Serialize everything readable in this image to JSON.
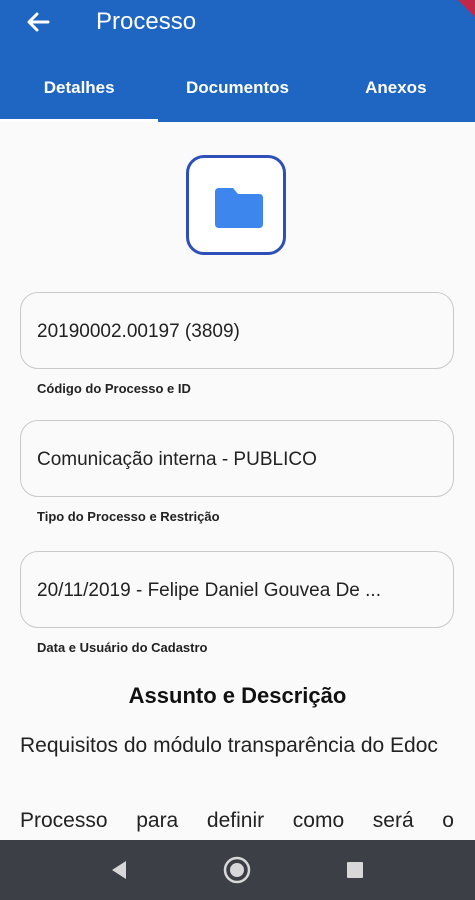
{
  "header": {
    "title": "Processo"
  },
  "tabs": [
    {
      "label": "Detalhes"
    },
    {
      "label": "Documentos"
    },
    {
      "label": "Anexos"
    }
  ],
  "fields": [
    {
      "value": "20190002.00197 (3809)",
      "label": "Código do Processo e ID"
    },
    {
      "value": "Comunicação interna - PUBLICO",
      "label": "Tipo do Processo e Restrição"
    },
    {
      "value": "20/11/2019 - Felipe Daniel Gouvea De ...",
      "label": "Data e Usuário do Cadastro"
    }
  ],
  "section": {
    "title": "Assunto e Descrição",
    "subject": "Requisitos do módulo transparência do Edoc",
    "description": "Processo para definir como será o"
  },
  "colors": {
    "appbar": "#1f65c2",
    "folder": "#3d86ee",
    "accent_border": "#2f4fb8"
  },
  "icons": {
    "back": "arrow-left-icon",
    "folder": "folder-icon",
    "nav_back": "triangle-back-icon",
    "nav_home": "circle-home-icon",
    "nav_recents": "square-recents-icon"
  }
}
